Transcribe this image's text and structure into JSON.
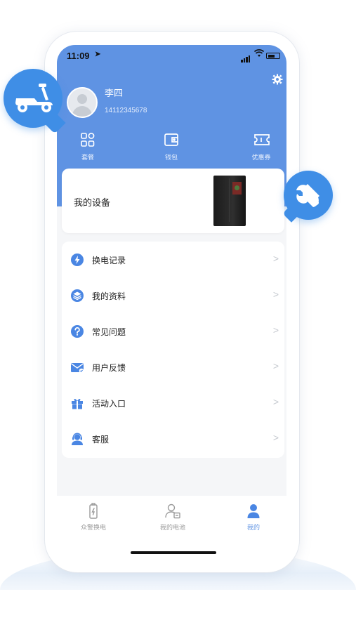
{
  "status": {
    "time": "11:09",
    "location_arrow": "➤"
  },
  "header": {
    "username": "李四",
    "phone": "14112345678",
    "settings_icon": "gear-icon"
  },
  "quick_actions": [
    {
      "label": "套餐",
      "icon": "grid-icon"
    },
    {
      "label": "钱包",
      "icon": "wallet-icon"
    },
    {
      "label": "优惠券",
      "icon": "ticket-icon"
    }
  ],
  "device_card": {
    "title": "我的设备",
    "image": "battery-cabinet"
  },
  "menu": [
    {
      "label": "换电记录",
      "icon": "bolt-icon"
    },
    {
      "label": "我的资料",
      "icon": "layers-icon"
    },
    {
      "label": "常见问题",
      "icon": "question-icon"
    },
    {
      "label": "用户反馈",
      "icon": "envelope-icon"
    },
    {
      "label": "活动入口",
      "icon": "gift-icon"
    },
    {
      "label": "客服",
      "icon": "headset-icon"
    }
  ],
  "menu_chevron": ">",
  "tabbar": [
    {
      "label": "众警换电",
      "icon": "battery-icon",
      "active": false
    },
    {
      "label": "我的电池",
      "icon": "person-card-icon",
      "active": false
    },
    {
      "label": "我的",
      "icon": "person-icon",
      "active": true
    }
  ],
  "colors": {
    "primary": "#5f93e3",
    "bubble": "#3f8ee6",
    "background": "#f5f6f8"
  }
}
